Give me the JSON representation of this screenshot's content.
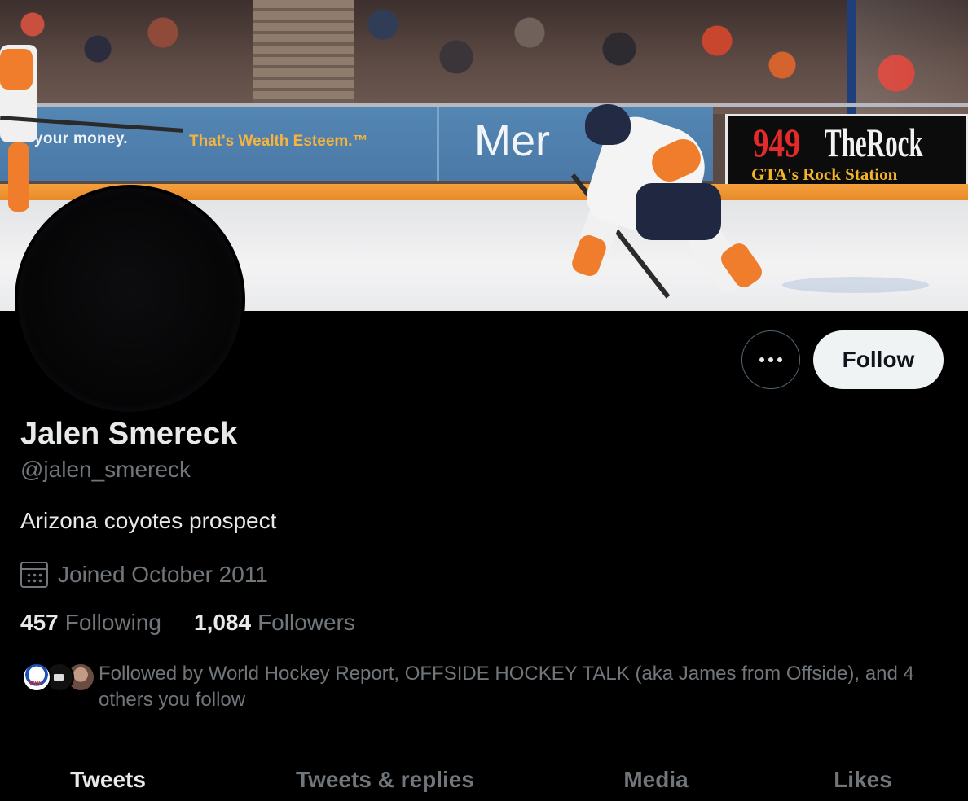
{
  "banner": {
    "ads": {
      "money_text": "your money.",
      "wealth_text": "That's Wealth Esteem.™",
      "mer_text": "Mer",
      "rock_number": "949",
      "rock_name": "TheRock",
      "rock_sub": "GTA's Rock Station"
    }
  },
  "profile": {
    "display_name": "Jalen Smereck",
    "handle": "@jalen_smereck",
    "bio": "Arizona coyotes prospect",
    "joined": "Joined October 2011",
    "following_count": "457",
    "following_label": "Following",
    "followers_count": "1,084",
    "followers_label": "Followers",
    "followed_by": "Followed by World Hockey Report, OFFSIDE HOCKEY TALK (aka James from Offside), and 4 others you follow",
    "mini_avatar_1_text": "WHR"
  },
  "actions": {
    "follow_label": "Follow",
    "more_icon": "more-horizontal-icon"
  },
  "tabs": [
    {
      "label": "Tweets",
      "active": true
    },
    {
      "label": "Tweets & replies",
      "active": false
    },
    {
      "label": "Media",
      "active": false
    },
    {
      "label": "Likes",
      "active": false
    }
  ],
  "colors": {
    "background": "#000000",
    "primary_text": "#e7e9ea",
    "secondary_text": "#71767b",
    "follow_button_bg": "#eff3f4",
    "follow_button_text": "#0f1419"
  }
}
